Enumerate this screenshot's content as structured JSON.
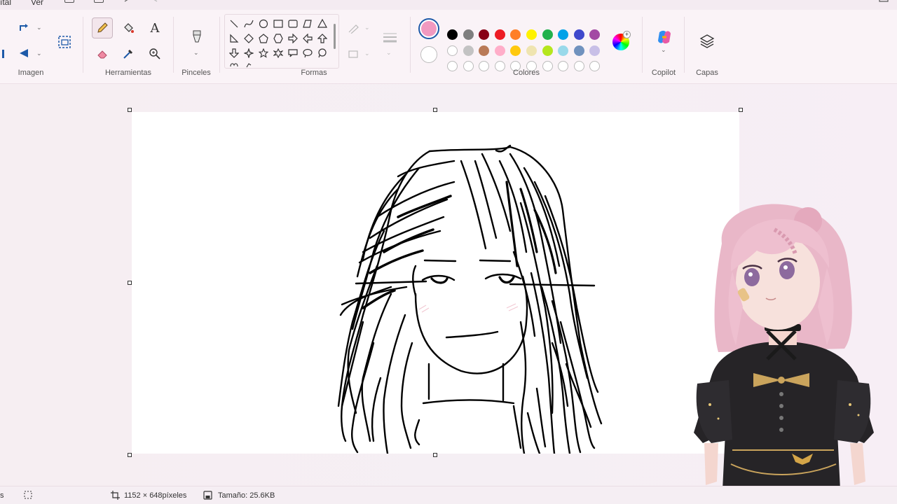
{
  "menu": {
    "left_fragment": "ıtal",
    "view": "Ver"
  },
  "ribbon": {
    "groups": {
      "imagen": "Imagen",
      "herramientas": "Herramientas",
      "pinceles": "Pinceles",
      "formas": "Formas",
      "colores": "Colores",
      "copilot": "Copilot",
      "capas": "Capas"
    },
    "text_tool_glyph": "A",
    "selected_tool": "pencil",
    "color1": "#f199c0",
    "color2": "#ffffff"
  },
  "palette": {
    "row1": [
      "#000000",
      "#7f7f7f",
      "#880015",
      "#ed1c24",
      "#ff7f27",
      "#fff200",
      "#22b14c",
      "#00a2e8",
      "#3f48cc",
      "#a349a4"
    ],
    "row2": [
      "#ffffff",
      "#c3c3c3",
      "#b97a57",
      "#ffaec9",
      "#ffc90e",
      "#efe4b0",
      "#b5e61d",
      "#99d9ea",
      "#7092be",
      "#c8bfe7"
    ],
    "row3_empty_count": 10
  },
  "status": {
    "left_fragment": "s",
    "dimensions": "1152 × 648píxeles",
    "size": "Tamaño: 25.6KB"
  }
}
